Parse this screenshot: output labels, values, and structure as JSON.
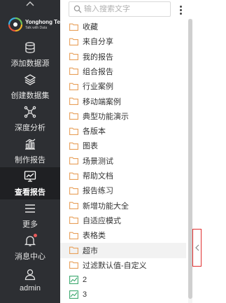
{
  "brand": {
    "name": "Yonghong Tech",
    "tagline": "Talk with Data"
  },
  "nav": [
    {
      "label": "添加数据源",
      "icon": "database-icon"
    },
    {
      "label": "创建数据集",
      "icon": "layers-icon"
    },
    {
      "label": "深度分析",
      "icon": "network-icon"
    },
    {
      "label": "制作报告",
      "icon": "bar-chart-icon"
    },
    {
      "label": "查看报告",
      "icon": "monitor-chart-icon",
      "active": true
    },
    {
      "label": "更多",
      "icon": "menu-icon"
    },
    {
      "label": "消息中心",
      "icon": "bell-icon",
      "badge": true
    },
    {
      "label": "admin",
      "icon": "user-icon"
    }
  ],
  "search": {
    "placeholder": "输入搜索文字"
  },
  "list": [
    {
      "label": "收藏",
      "type": "folder"
    },
    {
      "label": "来自分享",
      "type": "folder"
    },
    {
      "label": "我的报告",
      "type": "folder"
    },
    {
      "label": "组合报告",
      "type": "folder"
    },
    {
      "label": "行业案例",
      "type": "folder"
    },
    {
      "label": "移动端案例",
      "type": "folder"
    },
    {
      "label": "典型功能演示",
      "type": "folder"
    },
    {
      "label": "各版本",
      "type": "folder"
    },
    {
      "label": "图表",
      "type": "folder"
    },
    {
      "label": "场景测试",
      "type": "folder"
    },
    {
      "label": "帮助文档",
      "type": "folder"
    },
    {
      "label": "报告练习",
      "type": "folder"
    },
    {
      "label": "新增功能大全",
      "type": "folder"
    },
    {
      "label": "自适应模式",
      "type": "folder"
    },
    {
      "label": "表格类",
      "type": "folder"
    },
    {
      "label": "超市",
      "type": "folder",
      "hover": true
    },
    {
      "label": "过滤默认值-自定义",
      "type": "folder"
    },
    {
      "label": "2",
      "type": "report"
    },
    {
      "label": "3",
      "type": "report"
    }
  ],
  "colors": {
    "nav_bg": "#2d2f33",
    "folder": "#e8a05a",
    "report": "#3aa76d",
    "highlight": "#e03030"
  }
}
